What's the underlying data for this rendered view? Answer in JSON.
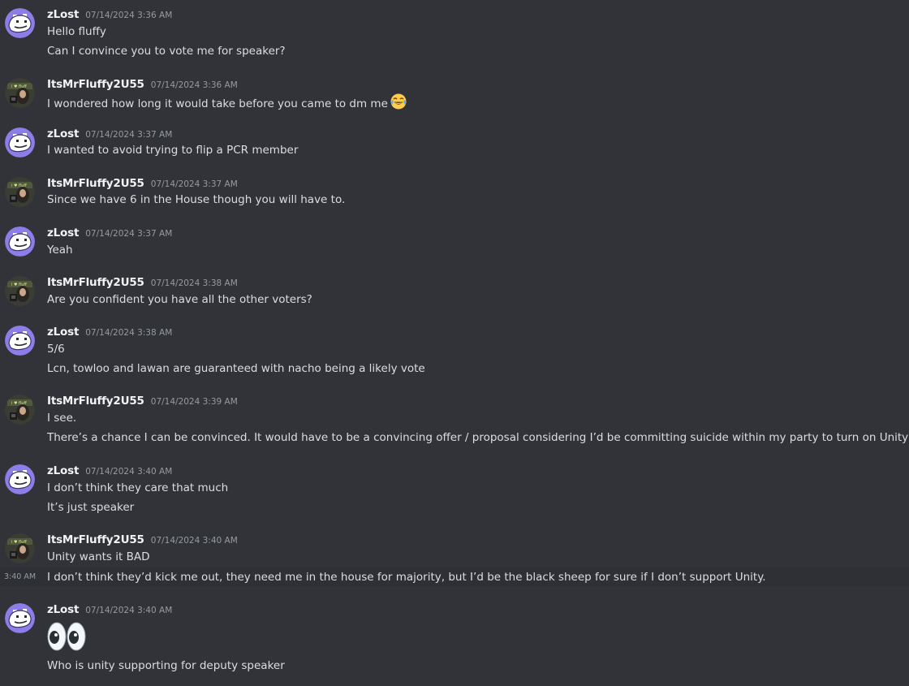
{
  "messages": [
    {
      "author": "zLost",
      "avatar": "zlost-avatar",
      "time": "07/14/2024 3:36 AM",
      "lines": [
        "Hello fluffy",
        "Can I convince you to vote me for speaker?"
      ]
    },
    {
      "author": "ItsMrFluffy2U55",
      "avatar": "fluffy-avatar",
      "time": "07/14/2024 3:36 AM",
      "lines": [
        "I wondered how long it would take before you came to dm me"
      ],
      "emoji": "laughing-crying-emoji"
    },
    {
      "author": "zLost",
      "avatar": "zlost-avatar",
      "time": "07/14/2024 3:37 AM",
      "lines": [
        "I wanted to avoid trying to flip a PCR member"
      ]
    },
    {
      "author": "ItsMrFluffy2U55",
      "avatar": "fluffy-avatar",
      "time": "07/14/2024 3:37 AM",
      "lines": [
        "Since we have 6 in the House though you will have to."
      ]
    },
    {
      "author": "zLost",
      "avatar": "zlost-avatar",
      "time": "07/14/2024 3:37 AM",
      "lines": [
        "Yeah"
      ]
    },
    {
      "author": "ItsMrFluffy2U55",
      "avatar": "fluffy-avatar",
      "time": "07/14/2024 3:38 AM",
      "lines": [
        "Are you confident you have all the other voters?"
      ]
    },
    {
      "author": "zLost",
      "avatar": "zlost-avatar",
      "time": "07/14/2024 3:38 AM",
      "lines": [
        "5/6",
        "Lcn, towloo and lawan are guaranteed with nacho being a likely vote"
      ]
    },
    {
      "author": "ItsMrFluffy2U55",
      "avatar": "fluffy-avatar",
      "time": "07/14/2024 3:39 AM",
      "lines": [
        "I see.",
        "There’s a chance I can be convinced. It would have to be a convincing offer / proposal considering I’d be committing suicide within my party to turn on Unity lol"
      ]
    },
    {
      "author": "zLost",
      "avatar": "zlost-avatar",
      "time": "07/14/2024 3:40 AM",
      "lines": [
        "I don’t think they care that much",
        "It’s just speaker"
      ]
    },
    {
      "author": "ItsMrFluffy2U55",
      "avatar": "fluffy-avatar",
      "time": "07/14/2024 3:40 AM",
      "lines": [
        "Unity wants it BAD"
      ],
      "hover_line": {
        "time": "3:40 AM",
        "text": "I don’t think they’d kick me out, they need me in the house for majority, but I’d be the black sheep for sure if I don’t support Unity."
      }
    },
    {
      "author": "zLost",
      "avatar": "zlost-avatar",
      "time": "07/14/2024 3:40 AM",
      "lines": [
        "Who is unity supporting for deputy speaker"
      ],
      "big_emoji": "eyes-emoji"
    }
  ],
  "colors": {
    "background": "#313338",
    "hover_background": "#2e3035",
    "username": "#f2f3f5",
    "text": "#dbdee1",
    "timestamp": "#949ba4"
  }
}
